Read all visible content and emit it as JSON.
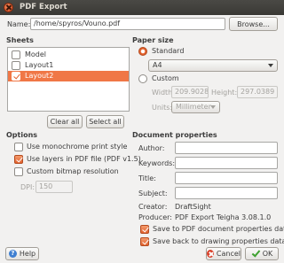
{
  "window": {
    "title": "PDF Export"
  },
  "name_row": {
    "label": "Name:",
    "value": "/home/spyros/Vouno.pdf",
    "browse_label": "Browse..."
  },
  "sheets": {
    "heading": "Sheets",
    "items": [
      {
        "label": "Model",
        "checked": false,
        "selected": false
      },
      {
        "label": "Layout1",
        "checked": false,
        "selected": false
      },
      {
        "label": "Layout2",
        "checked": true,
        "selected": true
      }
    ],
    "clear_all_label": "Clear all",
    "select_all_label": "Select all"
  },
  "paper": {
    "heading": "Paper size",
    "standard_label": "Standard",
    "standard_value": "A4",
    "custom_label": "Custom",
    "width_label": "Width:",
    "width_value": "209.9028",
    "height_label": "Height:",
    "height_value": "297.0389",
    "units_label": "Units:",
    "units_value": "Millimeter"
  },
  "options": {
    "heading": "Options",
    "monochrome_label": "Use monochrome print style",
    "monochrome_checked": false,
    "layers_label": "Use layers in PDF file (PDF v1.5)",
    "layers_checked": true,
    "bitmap_label": "Custom bitmap resolution",
    "bitmap_checked": false,
    "dpi_label": "DPI:",
    "dpi_value": "150"
  },
  "doc_props": {
    "heading": "Document properties",
    "author_label": "Author:",
    "author_value": "",
    "keywords_label": "Keywords:",
    "keywords_value": "",
    "title_label": "Title:",
    "title_value": "",
    "subject_label": "Subject:",
    "subject_value": "",
    "creator_label": "Creator:",
    "creator_value": "DraftSight",
    "producer_label": "Producer:",
    "producer_value": "PDF Export Teigha 3.08.1.0",
    "save_pdf_label": "Save to PDF document properties data",
    "save_pdf_checked": true,
    "save_drawing_label": "Save back to drawing properties data",
    "save_drawing_checked": true
  },
  "buttons": {
    "help_label": "Help",
    "cancel_label": "Cancel",
    "ok_label": "OK"
  },
  "colors": {
    "accent": "#e2622e",
    "selection": "#f07746",
    "titlebar": "#3c3b37",
    "background": "#f2f1f0"
  }
}
